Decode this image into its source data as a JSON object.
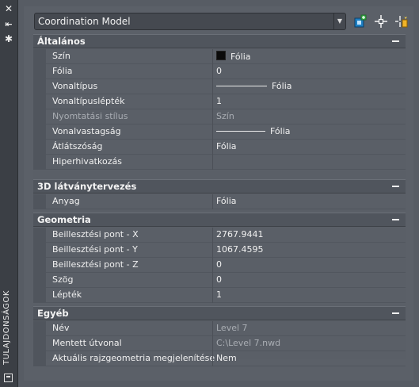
{
  "palette": {
    "vertical_title": "TULAJDONSÁGOK",
    "close_symbol": "✕",
    "autohide_symbol": "⇤",
    "settings_symbol": "✱"
  },
  "toolbar": {
    "selected_object": "Coordination Model",
    "dropdown_arrow": "▼"
  },
  "categories": [
    {
      "title": "Általános",
      "rows": [
        {
          "name": "Szín",
          "value": "Fólia"
        },
        {
          "name": "Fólia",
          "value": "0"
        },
        {
          "name": "Vonaltípus",
          "value": "Fólia"
        },
        {
          "name": "Vonaltípuslépték",
          "value": "1"
        },
        {
          "name": "Nyomtatási stílus",
          "value": "Szín"
        },
        {
          "name": "Vonalvastagság",
          "value": "Fólia"
        },
        {
          "name": "Átlátszóság",
          "value": "Fólia"
        },
        {
          "name": "Hiperhivatkozás",
          "value": ""
        }
      ]
    },
    {
      "title": "3D látványtervezés",
      "rows": [
        {
          "name": "Anyag",
          "value": "Fólia"
        }
      ]
    },
    {
      "title": "Geometria",
      "rows": [
        {
          "name": "Beillesztési pont - X",
          "value": "2767.9441"
        },
        {
          "name": "Beillesztési pont - Y",
          "value": "1067.4595"
        },
        {
          "name": "Beillesztési pont - Z",
          "value": "0"
        },
        {
          "name": "Szög",
          "value": "0"
        },
        {
          "name": "Lépték",
          "value": "1"
        }
      ]
    },
    {
      "title": "Egyéb",
      "rows": [
        {
          "name": "Név",
          "value": "Level 7"
        },
        {
          "name": "Mentett útvonal",
          "value": "C:\\Level 7.nwd"
        },
        {
          "name": "Aktuális rajzgeometria megjelenítése",
          "value": "Nem"
        }
      ]
    }
  ],
  "colors": {
    "swatch": "#0b0b0b",
    "dim_text": "#a9adb3"
  }
}
